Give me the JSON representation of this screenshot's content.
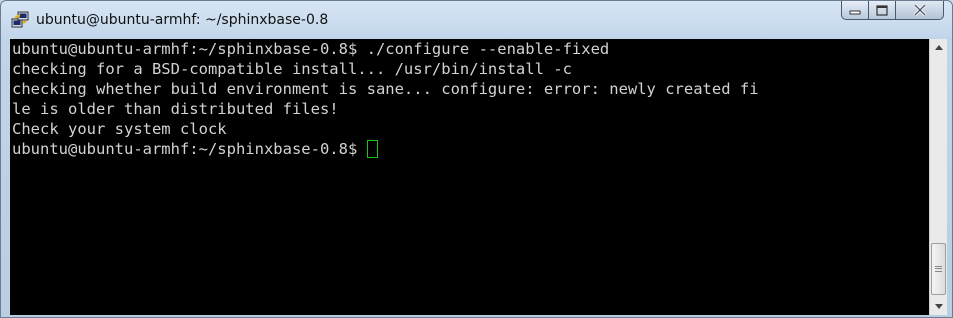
{
  "window": {
    "title": "ubuntu@ubuntu-armhf: ~/sphinxbase-0.8"
  },
  "terminal": {
    "lines": [
      "ubuntu@ubuntu-armhf:~/sphinxbase-0.8$ ./configure --enable-fixed",
      "checking for a BSD-compatible install... /usr/bin/install -c",
      "checking whether build environment is sane... configure: error: newly created fi",
      "le is older than distributed files!",
      "Check your system clock",
      "ubuntu@ubuntu-armhf:~/sphinxbase-0.8$ "
    ],
    "cursor_color": "#19c319"
  },
  "icons": {
    "app": "putty-icon",
    "minimize": "minimize-icon",
    "maximize": "maximize-icon",
    "close": "close-icon",
    "scroll_up": "arrow-up-icon",
    "scroll_down": "arrow-down-icon"
  }
}
